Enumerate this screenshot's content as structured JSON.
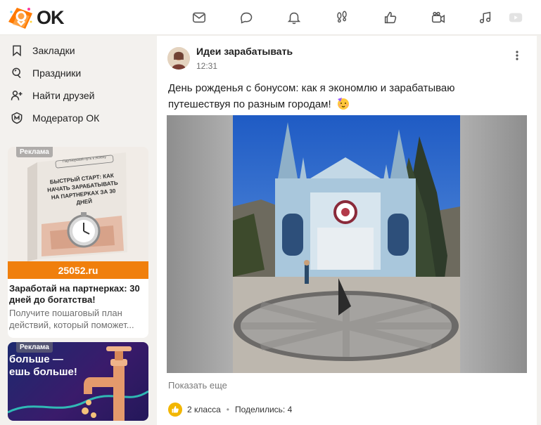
{
  "app": {
    "logo_text": "OK",
    "brand_color": "#ff7700"
  },
  "topnav": {
    "items": [
      {
        "icon": "mail-icon"
      },
      {
        "icon": "chat-icon"
      },
      {
        "icon": "bell-icon"
      },
      {
        "icon": "footprints-icon"
      },
      {
        "icon": "thumbs-up-icon"
      },
      {
        "icon": "video-camera-icon"
      },
      {
        "icon": "music-icon"
      },
      {
        "icon": "video-play-icon"
      }
    ]
  },
  "sidebar": {
    "items": [
      {
        "label": "Закладки",
        "icon": "bookmark-icon"
      },
      {
        "label": "Праздники",
        "icon": "holidays-icon"
      },
      {
        "label": "Найти друзей",
        "icon": "add-friend-icon"
      },
      {
        "label": "Модератор ОК",
        "icon": "moderator-icon"
      }
    ]
  },
  "ads": [
    {
      "label": "Реклама",
      "book_header": "Партнерский путь к Успеху",
      "book_title": "БЫСТРЫЙ СТАРТ: КАК НАЧАТЬ ЗАРАБАТЫВАТЬ НА ПАРТНЕРКАХ ЗА 30 ДНЕЙ",
      "domain": "25052.ru",
      "title": "Заработай на партнерках: 30 дней до богатства!",
      "description": "Получите пошаговый план действий, который поможет..."
    },
    {
      "label": "Реклама",
      "image_text_line1": "больше —",
      "image_text_line2": "ешь больше!"
    }
  ],
  "post": {
    "author": "Идеи зарабатывать",
    "time": "12:31",
    "text": "День рожденья с бонусом: как я экономлю и зарабатываю путешествуя по разным городам!",
    "show_more": "Показать еще",
    "likes": "2 класса",
    "shares": "Поделились: 4",
    "like_color": "#f2b600"
  }
}
